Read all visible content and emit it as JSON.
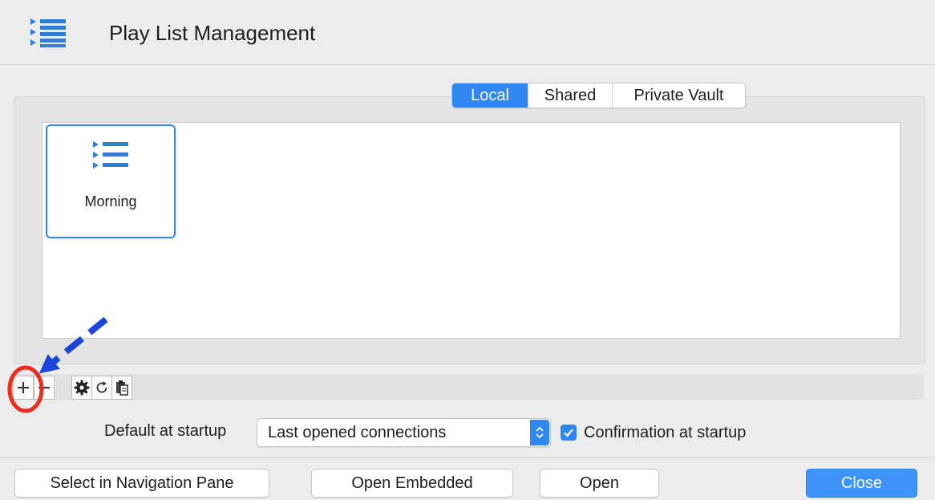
{
  "window": {
    "title": "Play List Management",
    "icon": "playlist-icon"
  },
  "tabs": [
    {
      "label": "Local",
      "selected": true
    },
    {
      "label": "Shared",
      "selected": false
    },
    {
      "label": "Private Vault",
      "selected": false
    }
  ],
  "playlists": [
    {
      "name": "Morning",
      "icon": "playlist-icon",
      "selected": true
    }
  ],
  "toolbar": {
    "add": "+",
    "remove": "−",
    "icons": [
      "plus-icon",
      "minus-icon",
      "gear-icon",
      "refresh-icon",
      "clipboard-icon"
    ]
  },
  "startup": {
    "label": "Default at startup",
    "selected_option": "Last opened connections",
    "confirm_label": "Confirmation at startup",
    "confirm_checked": true
  },
  "buttons": {
    "select_nav": "Select in Navigation Pane",
    "open_embedded": "Open Embedded",
    "open": "Open",
    "close": "Close"
  },
  "colors": {
    "accent": "#2f87ef",
    "annotation_arrow": "#1b45d8",
    "annotation_circle": "#e8301e"
  }
}
